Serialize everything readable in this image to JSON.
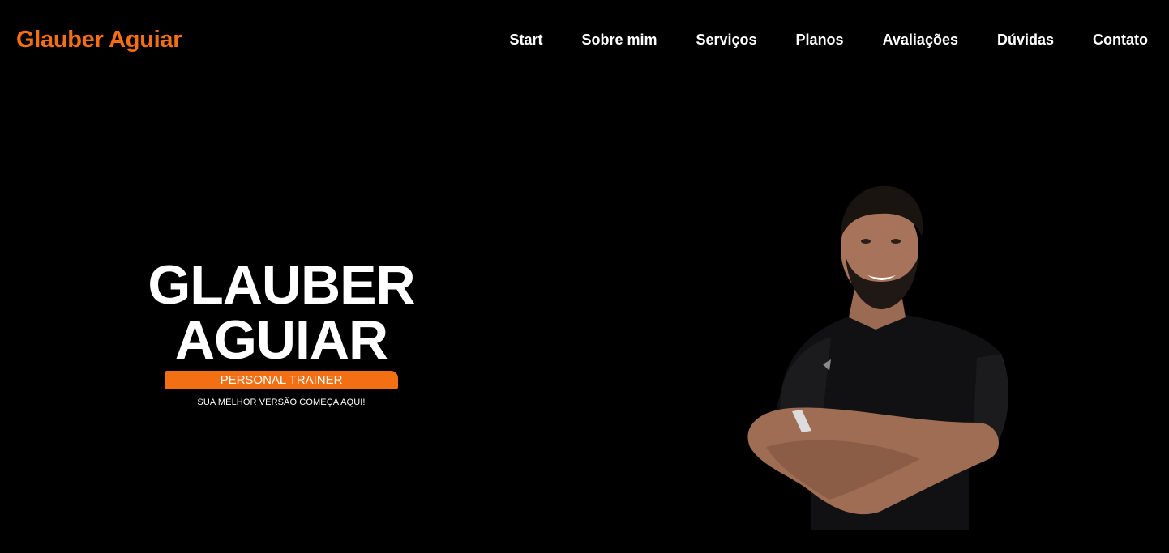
{
  "header": {
    "brand": "Glauber Aguiar",
    "nav": [
      {
        "label": "Start"
      },
      {
        "label": "Sobre mim"
      },
      {
        "label": "Serviços"
      },
      {
        "label": "Planos"
      },
      {
        "label": "Avaliações"
      },
      {
        "label": "Dúvidas"
      },
      {
        "label": "Contato"
      }
    ]
  },
  "hero": {
    "name_line1": "GLAUBER",
    "name_line2": "AGUIAR",
    "role": "PERSONAL TRAINER",
    "tagline": "SUA MELHOR VERSÃO COMEÇA AQUI!",
    "image": "trainer-photo"
  },
  "colors": {
    "background": "#000000",
    "accent": "#f36f13",
    "text": "#ffffff"
  }
}
